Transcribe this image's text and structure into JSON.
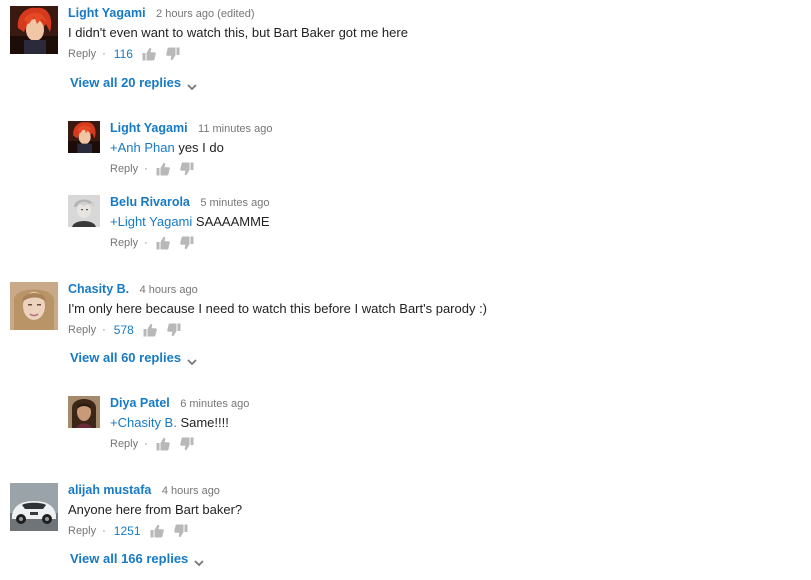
{
  "colors": {
    "link": "#167ac6",
    "meta": "#767676",
    "text": "#222222"
  },
  "threads": [
    {
      "author": "Light Yagami",
      "time": "2 hours ago (edited)",
      "text": "I didn't even want to watch this, but Bart Baker got me here",
      "reply": "Reply",
      "likes": "116",
      "view_all": "View all 20 replies",
      "avatar": "red-haired-character-avatar",
      "replies": [
        {
          "author": "Light Yagami",
          "time": "11 minutes ago",
          "mention": "+Anh Phan",
          "text": " yes I do",
          "reply": "Reply",
          "avatar": "red-haired-character-avatar"
        },
        {
          "author": "Belu Rivarola",
          "time": "5 minutes ago",
          "mention": "+Light Yagami",
          "text": " SAAAAMME",
          "reply": "Reply",
          "avatar": "grayscale-portrait-avatar"
        }
      ]
    },
    {
      "author": "Chasity B.",
      "time": "4 hours ago",
      "text": "I'm only here because I need to watch this before I watch Bart's parody :)",
      "reply": "Reply",
      "likes": "578",
      "view_all": "View all 60 replies",
      "avatar": "blonde-woman-avatar",
      "replies": [
        {
          "author": "Diya Patel",
          "time": "6 minutes ago",
          "mention": "+Chasity B.",
          "text": " Same!!!!",
          "reply": "Reply",
          "avatar": "dark-haired-woman-avatar"
        }
      ]
    },
    {
      "author": "alijah mustafa",
      "time": "4 hours ago",
      "text": "Anyone here from Bart baker?",
      "reply": "Reply",
      "likes": "1251",
      "view_all": "View all 166 replies",
      "avatar": "white-sports-car-avatar"
    }
  ]
}
